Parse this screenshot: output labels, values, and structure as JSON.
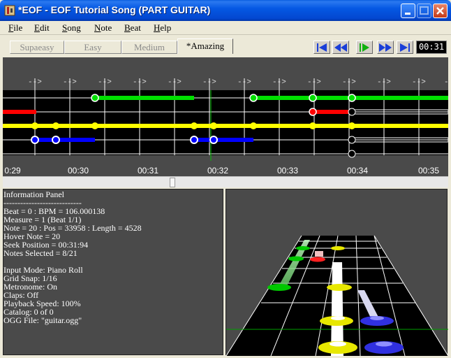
{
  "window": {
    "title": "*EOF - EOF Tutorial Song (PART GUITAR)"
  },
  "menu": {
    "items": [
      {
        "first": "F",
        "rest": "ile"
      },
      {
        "first": "E",
        "rest": "dit"
      },
      {
        "first": "S",
        "rest": "ong"
      },
      {
        "first": "N",
        "rest": "ote"
      },
      {
        "first": "B",
        "rest": "eat"
      },
      {
        "first": "H",
        "rest": "elp"
      }
    ]
  },
  "difficulty_tabs": [
    "Supaeasy",
    "Easy",
    "Medium",
    "*Amazing"
  ],
  "active_difficulty": "*Amazing",
  "transport": {
    "buttons": [
      "seek-start",
      "rewind",
      "play",
      "fast-forward",
      "seek-end"
    ],
    "time": "00:31"
  },
  "timeline": {
    "beat_marker": "-->",
    "tick_labels": [
      "0:29",
      "00:30",
      "00:31",
      "00:32",
      "00:33",
      "00:34",
      "00:35"
    ],
    "lane_colors": [
      "#00e000",
      "#ff0000",
      "#ffff00",
      "#0000ff"
    ]
  },
  "info_panel": {
    "lines": [
      "Information Panel",
      "----------------------------",
      "Beat = 0 : BPM = 106.000138",
      "Measure = 1 (Beat 1/1)",
      "Note = 20 : Pos = 33958 : Length = 4528",
      "Hover Note = 20",
      "Seek Position = 00:31:94",
      "Notes Selected = 8/21",
      "",
      "Input Mode: Piano Roll",
      "Grid Snap: 1/16",
      "Metronome: On",
      "Claps: Off",
      "Playback Speed: 100%",
      "Catalog: 0 of 0",
      "OGG File: \"guitar.ogg\""
    ]
  },
  "colors": {
    "green": "#00e000",
    "red": "#ff0000",
    "yellow": "#ffff00",
    "blue": "#0000ff",
    "panel": "#4a4a4a"
  }
}
